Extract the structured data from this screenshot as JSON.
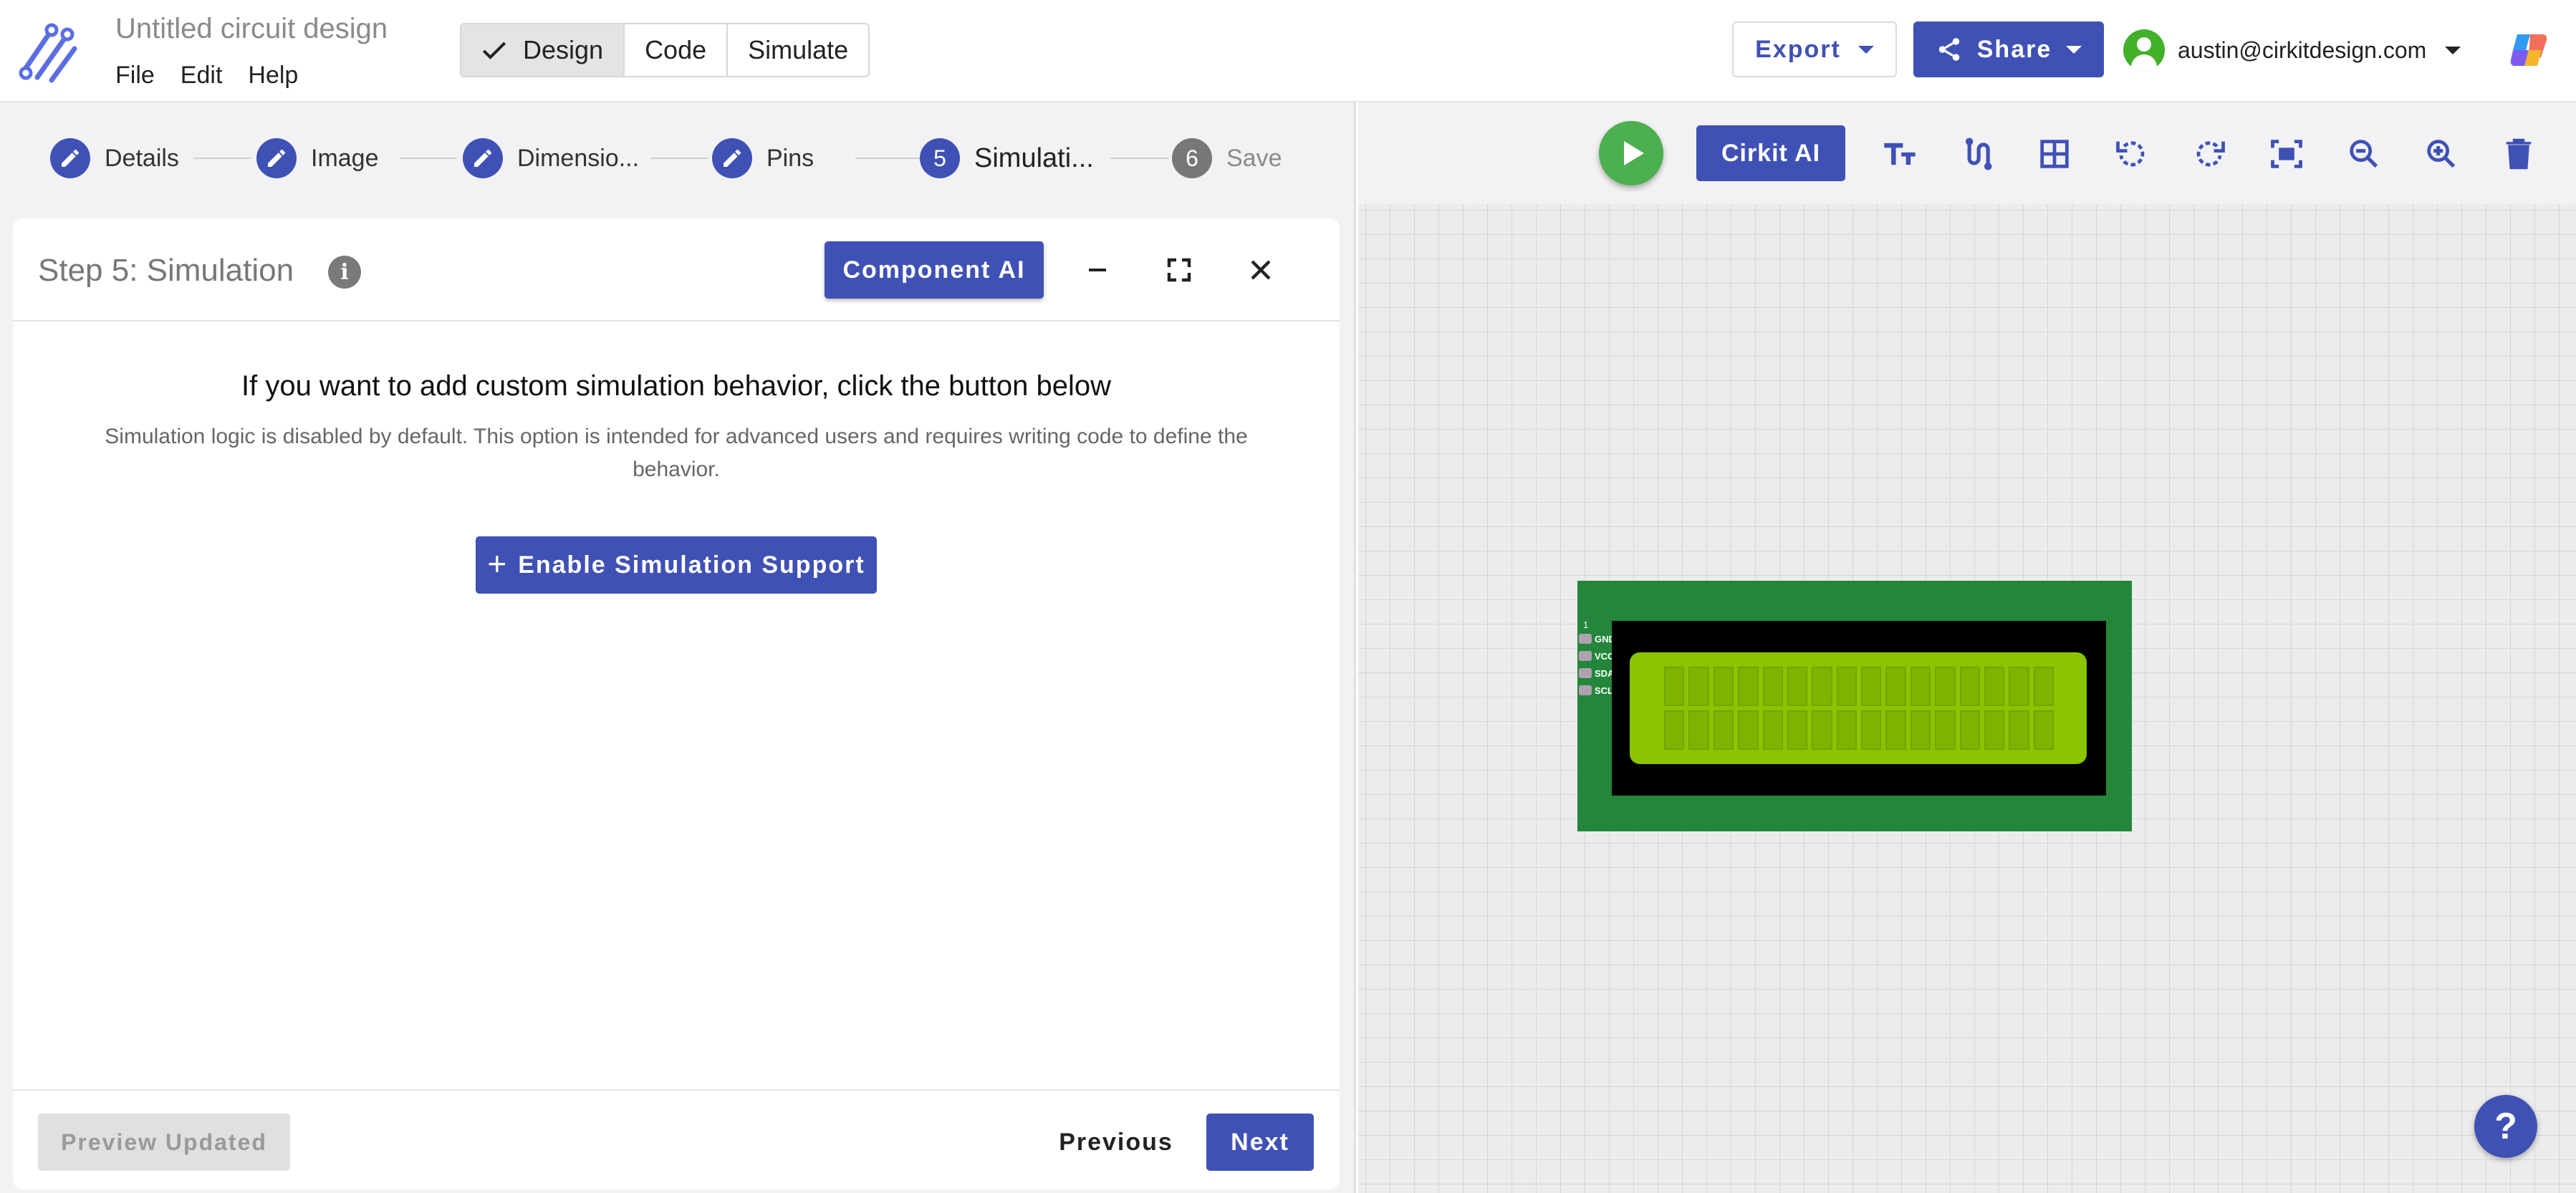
{
  "app": {
    "doc_title": "Untitled circuit design",
    "menu": [
      "File",
      "Edit",
      "Help"
    ],
    "modes": [
      "Design",
      "Code",
      "Simulate"
    ],
    "export_label": "Export",
    "share_label": "Share",
    "user_email": "austin@cirkitdesign.com"
  },
  "stepper": {
    "steps": [
      {
        "label": "Details",
        "state": "completed"
      },
      {
        "label": "Image",
        "state": "completed"
      },
      {
        "label": "Dimensio...",
        "state": "completed"
      },
      {
        "label": "Pins",
        "state": "completed"
      },
      {
        "label": "Simulati...",
        "number": "5",
        "state": "active"
      },
      {
        "label": "Save",
        "number": "6",
        "state": "pending"
      }
    ]
  },
  "panel": {
    "title": "Step 5: Simulation",
    "info_glyph": "i",
    "component_ai_label": "Component AI",
    "headline": "If you want to add custom simulation behavior, click the button below",
    "subtext": "Simulation logic is disabled by default. This option is intended for advanced users and requires writing code to define the behavior.",
    "enable_label": "Enable Simulation Support",
    "enable_icon": "+",
    "preview_label": "Preview Updated",
    "previous_label": "Previous",
    "next_label": "Next"
  },
  "canvas": {
    "cirkit_ai_label": "Cirkit AI",
    "tools": [
      "text-size-icon",
      "route-icon",
      "grid-icon",
      "rotate-left-icon",
      "rotate-right-icon",
      "fit-screen-icon",
      "zoom-out-icon",
      "zoom-in-icon",
      "delete-icon"
    ],
    "lcd": {
      "pin_start": "1",
      "pins": [
        "GND",
        "VCC",
        "SDA",
        "SCL"
      ]
    },
    "help_label": "?"
  },
  "colors": {
    "primary": "#3f51b5",
    "run": "#4caf50",
    "pcb": "#23863b",
    "lcd_glass": "#8bc400"
  }
}
